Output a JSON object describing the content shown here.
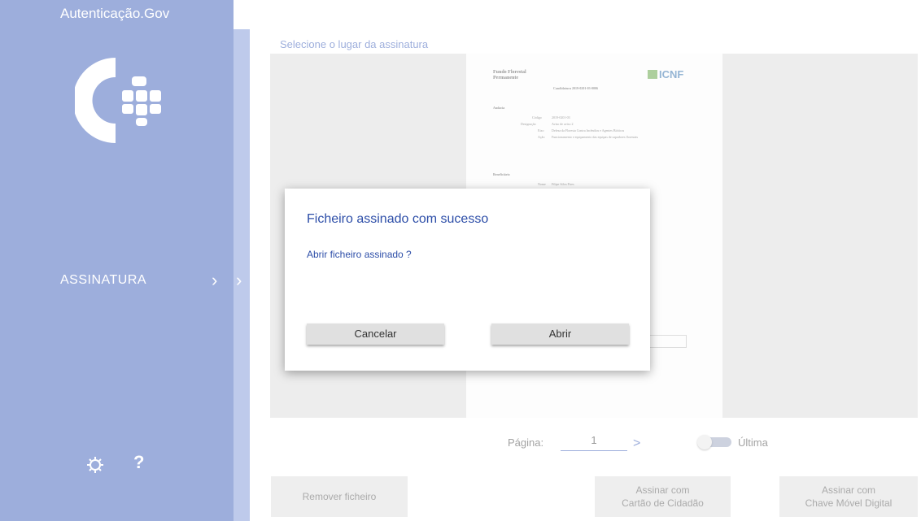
{
  "window": {
    "title": "Autenticação.Gov",
    "minimize_glyph": "—",
    "maximize_glyph": "☐",
    "close_glyph": "✕"
  },
  "sidebar": {
    "nav_item": "ASSINATURA",
    "chevron_glyph": "›",
    "help_glyph": "?",
    "icons": [
      "settings-gear-icon",
      "help-icon"
    ]
  },
  "main": {
    "section_title": "Selecione o lugar da assinatura",
    "document": {
      "org_line1": "Fundo Florestal",
      "org_line2": "Permanente",
      "logo_text": "ICNF",
      "ref": "Candidatura 2019-0201-03-0006",
      "section1": "Audacia",
      "code_label": "Código",
      "code_value": "2019-0201-03",
      "designation_label": "Designação",
      "designation_value": "Aviso de aviso 2",
      "axis_label": "Eixo",
      "axis_value": "Defesa da Floresta Contra Incêndios e Agentes Bióticos",
      "action_label": "Ação",
      "action_value": "Funcionamento e equipamento das equipas de sapadores florestais",
      "section2": "Beneficiário",
      "name_label": "Nome",
      "name_value": "Filipe Silva Pires"
    },
    "pagination": {
      "label": "Página:",
      "value": "1",
      "next_glyph": ">",
      "last_label": "Última",
      "last_toggle_on": false
    },
    "buttons": {
      "remove": "Remover ficheiro",
      "sign_cc_line1": "Assinar com",
      "sign_cc_line2": "Cartão de Cidadão",
      "sign_cmd_line1": "Assinar com",
      "sign_cmd_line2": "Chave Móvel Digital"
    }
  },
  "dialog": {
    "title": "Ficheiro assinado com sucesso",
    "message": "Abrir ficheiro assinado ?",
    "cancel_label": "Cancelar",
    "open_label": "Abrir"
  },
  "colors": {
    "brand_blue": "#3b5db8",
    "strip_blue": "#7d95d6",
    "dialog_text": "#2d4ea8"
  }
}
